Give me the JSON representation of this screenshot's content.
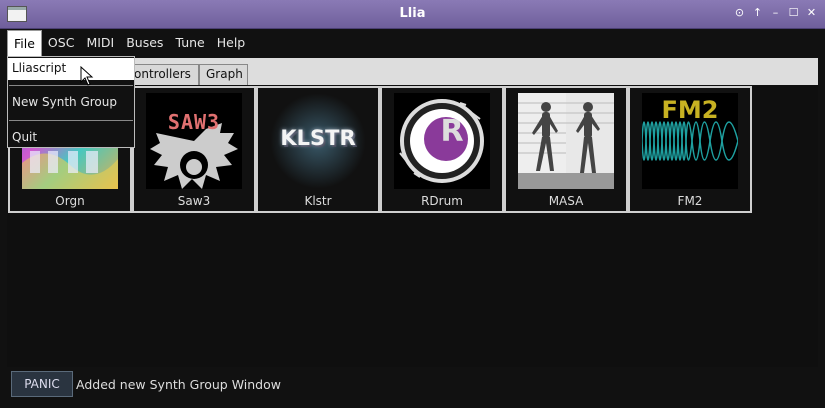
{
  "window": {
    "title": "Llia",
    "buttons": [
      "⊙",
      "↑",
      "–",
      "☐",
      "✕"
    ]
  },
  "menubar": [
    "File",
    "OSC",
    "MIDI",
    "Buses",
    "Tune",
    "Help"
  ],
  "tabs": [
    "ontrollers",
    "Graph"
  ],
  "file_menu": {
    "items": [
      "Lliascript",
      "New Synth Group",
      "Quit"
    ]
  },
  "synths": [
    {
      "label": "Orgn"
    },
    {
      "label": "Saw3",
      "art_text": "SAW3"
    },
    {
      "label": "Klstr",
      "art_text": "KLSTR"
    },
    {
      "label": "RDrum",
      "art_text": "R"
    },
    {
      "label": "MASA"
    },
    {
      "label": "FM2",
      "art_text": "FM2"
    }
  ],
  "status": {
    "panic_label": "PANIC",
    "message": "Added new Synth Group Window"
  },
  "colors": {
    "titlebar": "#7a6aa8",
    "background": "#111111",
    "fm2_text": "#c8b222",
    "saw3_text": "#e07070"
  }
}
